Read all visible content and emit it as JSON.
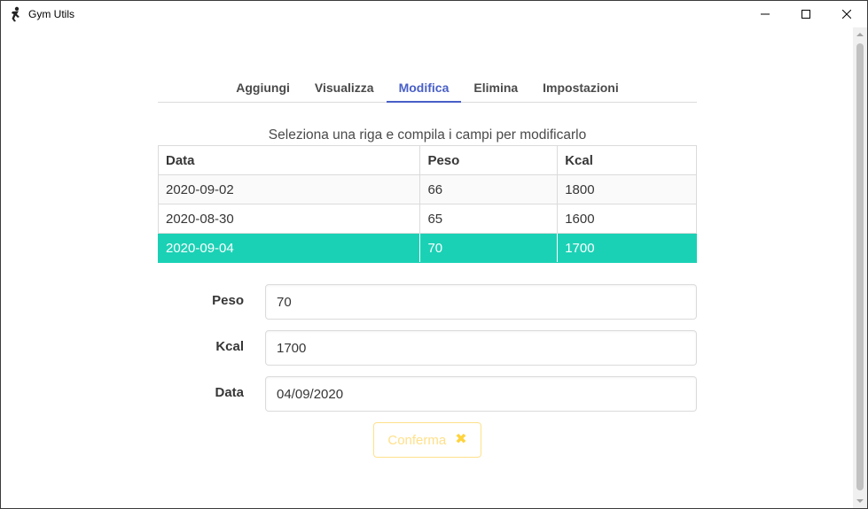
{
  "window": {
    "title": "Gym Utils",
    "icon": "figure-icon"
  },
  "tabs": [
    {
      "label": "Aggiungi",
      "active": false
    },
    {
      "label": "Visualizza",
      "active": false
    },
    {
      "label": "Modifica",
      "active": true
    },
    {
      "label": "Elimina",
      "active": false
    },
    {
      "label": "Impostazioni",
      "active": false
    }
  ],
  "instructions": "Seleziona una riga e compila i campi per modificarlo",
  "table": {
    "columns": [
      "Data",
      "Peso",
      "Kcal"
    ],
    "rows": [
      [
        "2020-09-02",
        "66",
        "1800"
      ],
      [
        "2020-08-30",
        "65",
        "1600"
      ],
      [
        "2020-09-04",
        "70",
        "1700"
      ]
    ],
    "selected_row": 2
  },
  "form": {
    "peso": {
      "label": "Peso",
      "value": "70"
    },
    "kcal": {
      "label": "Kcal",
      "value": "1700"
    },
    "data": {
      "label": "Data",
      "value": "04/09/2020"
    }
  },
  "confirm": {
    "label": "Conferma",
    "icon": "close-icon"
  },
  "colors": {
    "accent": "#485fc7",
    "selected_row": "#1bd1b5",
    "warning": "#ffe08a"
  }
}
